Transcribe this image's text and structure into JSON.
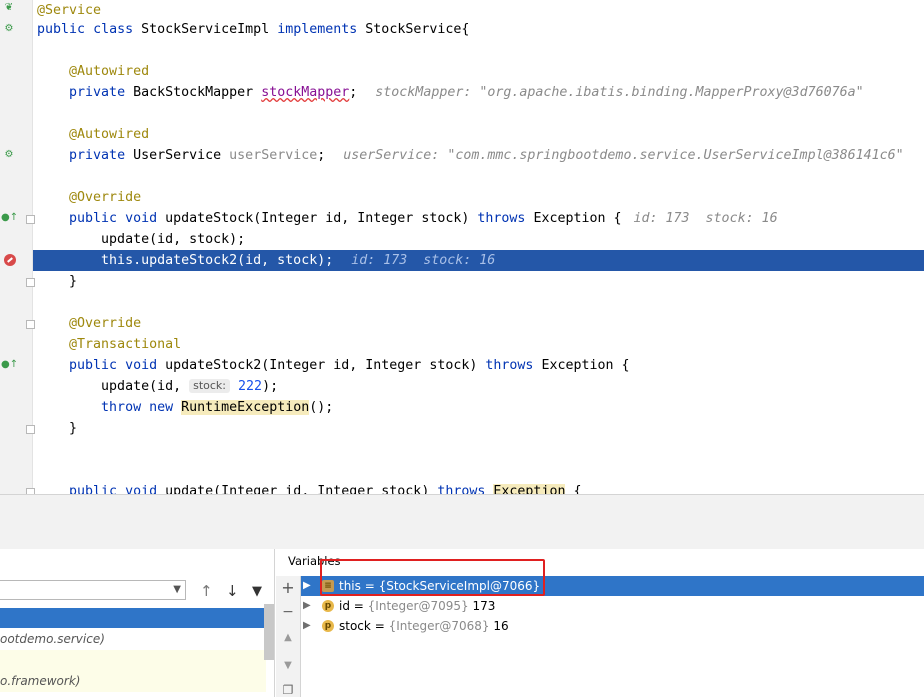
{
  "editor": {
    "lines": {
      "l1": {
        "ann": "@Service"
      },
      "l2": {
        "public": "public",
        "class": "class",
        "name": "StockServiceImpl",
        "implements": "implements",
        "iface": "StockService{"
      },
      "l4": {
        "ann": "@Autowired"
      },
      "l5": {
        "private": "private",
        "type": "BackStockMapper",
        "field": "stockMapper",
        "semi": ";",
        "hint": "stockMapper: \"org.apache.ibatis.binding.MapperProxy@3d76076a\""
      },
      "l7": {
        "ann": "@Autowired"
      },
      "l8": {
        "private": "private",
        "type": "UserService",
        "field": "userService",
        "semi": ";",
        "hint": "userService: \"com.mmc.springbootdemo.service.UserServiceImpl@386141c6\""
      },
      "l10": {
        "ann": "@Override"
      },
      "l11": {
        "public": "public",
        "void": "void",
        "sig": "updateStock(Integer id, Integer stock)",
        "throws": "throws",
        "exc": "Exception {",
        "hint_id": "id: 173",
        "hint_stock": "stock: 16"
      },
      "l12": {
        "code": "update(id, stock);"
      },
      "l13": {
        "this": "this",
        "rest": ".updateStock2(id, stock);",
        "hint_id": "id: 173",
        "hint_stock": "stock: 16"
      },
      "l14": {
        "code": "}"
      },
      "l16": {
        "ann": "@Override"
      },
      "l17": {
        "ann": "@Transactional"
      },
      "l18": {
        "public": "public",
        "void": "void",
        "sig": "updateStock2(Integer id, Integer stock)",
        "throws": "throws",
        "exc": "Exception {"
      },
      "l19": {
        "pre": "update(id, ",
        "param_hint": "stock:",
        "num": "222",
        "post": ");"
      },
      "l20": {
        "throw": "throw",
        "new": "new",
        "cls": "RuntimeException",
        "post": "();"
      },
      "l21": {
        "code": "}"
      },
      "l24": {
        "public": "public",
        "void": "void",
        "sig": "update(Integer id, Integer stock)",
        "throws": "throws",
        "exc": "Exception",
        "brace": "{"
      }
    }
  },
  "debugger": {
    "variables_title": "Variables",
    "frames": [
      {
        "text": "ootdemo.service)"
      },
      {
        "text": "o.framework)"
      }
    ],
    "variables": [
      {
        "name": "this",
        "value": "= {StockServiceImpl@7066}",
        "icon": "object-icon",
        "selected": true
      },
      {
        "name": "id",
        "eq": "=",
        "type": "{Integer@7095}",
        "value": "173",
        "icon": "p"
      },
      {
        "name": "stock",
        "eq": "=",
        "type": "{Integer@7068}",
        "value": "16",
        "icon": "p"
      }
    ],
    "tools": {
      "plus": "+",
      "minus": "−",
      "up": "↑",
      "down": "↓",
      "filter": "▼"
    }
  },
  "colors": {
    "highlight": "#2457a8",
    "selection": "#2f75c8",
    "annotation": "#e02020",
    "keyword": "#0033b3"
  }
}
